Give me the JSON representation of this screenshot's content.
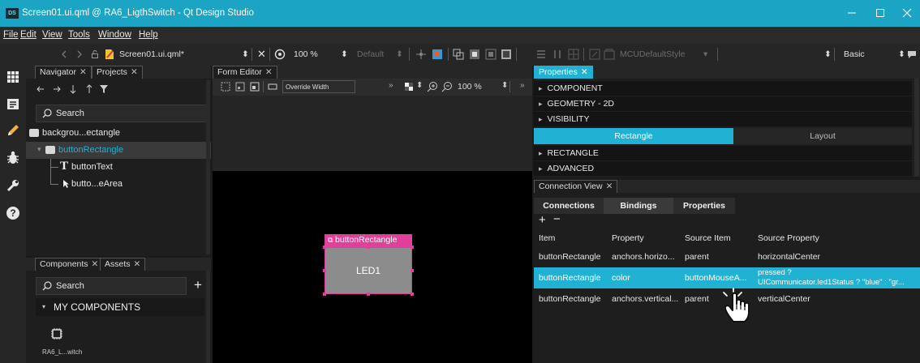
{
  "window": {
    "app_icon_text": "DS",
    "title": "Screen01.ui.qml @ RA6_LigthSwitch - Qt Design Studio"
  },
  "menu": [
    "File",
    "Edit",
    "View",
    "Tools",
    "Window",
    "Help"
  ],
  "toolbar": {
    "file_name": "Screen01.ui.qml*",
    "zoom": "100 %",
    "style_default": "Default",
    "style_name": "MCUDefaultStyle",
    "workspace": "Basic"
  },
  "navigator": {
    "tabs": [
      "Navigator",
      "Projects"
    ],
    "search_placeholder": "Search",
    "items": [
      {
        "label": "backgrou...ectangle"
      },
      {
        "label": "buttonRectangle"
      },
      {
        "label": "buttonText"
      },
      {
        "label": "butto...eArea"
      }
    ]
  },
  "components": {
    "tabs": [
      "Components",
      "Assets"
    ],
    "search_placeholder": "Search",
    "section_title": "MY COMPONENTS",
    "item_label": "RA6_L...witch"
  },
  "form_editor": {
    "tab": "Form Editor",
    "override_label": "Override Width",
    "zoom": "100 %",
    "selection_label": "buttonRectangle",
    "button_text": "LED1"
  },
  "properties": {
    "tab": "Properties",
    "sections_top": [
      "COMPONENT",
      "GEOMETRY - 2D",
      "VISIBILITY"
    ],
    "subtabs": [
      "Rectangle",
      "Layout"
    ],
    "sections_bottom": [
      "RECTANGLE",
      "ADVANCED"
    ]
  },
  "connection_view": {
    "tab": "Connection View",
    "tabs": [
      "Connections",
      "Bindings",
      "Properties"
    ],
    "add": "+",
    "remove": "−",
    "columns": [
      "Item",
      "Property",
      "Source Item",
      "Source Property"
    ],
    "rows": [
      {
        "item": "buttonRectangle",
        "property": "anchors.horizo...",
        "source_item": "parent",
        "source_property_1": "horizontalCenter",
        "source_property_2": ""
      },
      {
        "item": "buttonRectangle",
        "property": "color",
        "source_item": "buttonMouseA...",
        "source_property_1": "pressed ?",
        "source_property_2": "UICommunicator.led1Status ? \"blue\" : \"gr..."
      },
      {
        "item": "buttonRectangle",
        "property": "anchors.vertical...",
        "source_item": "parent",
        "source_property_1": "verticalCenter",
        "source_property_2": ""
      }
    ]
  },
  "colors": {
    "accent": "#20b1d3",
    "selection_magenta": "#e0409a",
    "title_bar": "#1ba4c3"
  }
}
